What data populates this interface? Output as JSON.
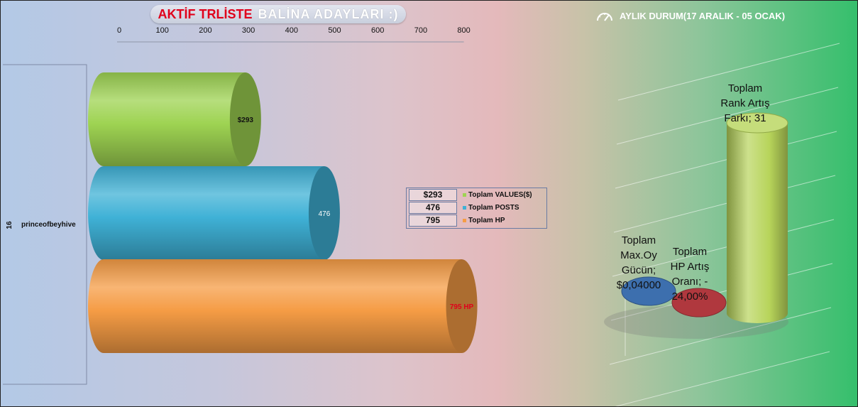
{
  "title": {
    "part1": "AKTİF TRLİSTE",
    "part2": "BALİNA ADAYLARI :)"
  },
  "status_title": "AYLIK DURUM(17 ARALIK - 05 OCAK)",
  "icons": {
    "status": "speedometer-icon"
  },
  "colors": {
    "values": "#9ed352",
    "posts": "#3fb1d6",
    "hp": "#f59c45",
    "max_vote": "#3d6fae",
    "hp_rate": "#b0383e",
    "rank": "#b7d45a",
    "label_red": "#e0001b"
  },
  "chart_data": [
    {
      "type": "bar",
      "orientation": "horizontal",
      "categories": [
        "princeofbeyhive"
      ],
      "rank_label": "16",
      "x_ticks": [
        "0",
        "100",
        "200",
        "300",
        "400",
        "500",
        "600",
        "700",
        "800"
      ],
      "xlim": [
        0,
        800
      ],
      "series": [
        {
          "name": "Toplam VALUES($)",
          "values": [
            293
          ],
          "label": "$293",
          "legend_value": "$293"
        },
        {
          "name": "Toplam POSTS",
          "values": [
            476
          ],
          "label": "476",
          "legend_value": "476"
        },
        {
          "name": "Toplam HP",
          "values": [
            795
          ],
          "label": "795 HP",
          "legend_value": "795"
        }
      ],
      "legend": "right"
    },
    {
      "type": "bar",
      "title": "AYLIK DURUM(17 ARALIK - 05 OCAK)",
      "categories": [
        "Toplam Max.Oy Gücün",
        "Toplam HP Artış Oranı",
        "Toplam Rank Artış Farkı"
      ],
      "values": [
        0.04,
        -24.0,
        31
      ],
      "labels": [
        [
          "Toplam",
          "Max.Oy",
          "Gücün;",
          "$0,04000"
        ],
        [
          "Toplam",
          "HP Artış",
          "Oranı; -",
          "24,00%"
        ],
        [
          "Toplam",
          "Rank Artış",
          "Farkı; 31"
        ]
      ],
      "grid": true
    }
  ]
}
